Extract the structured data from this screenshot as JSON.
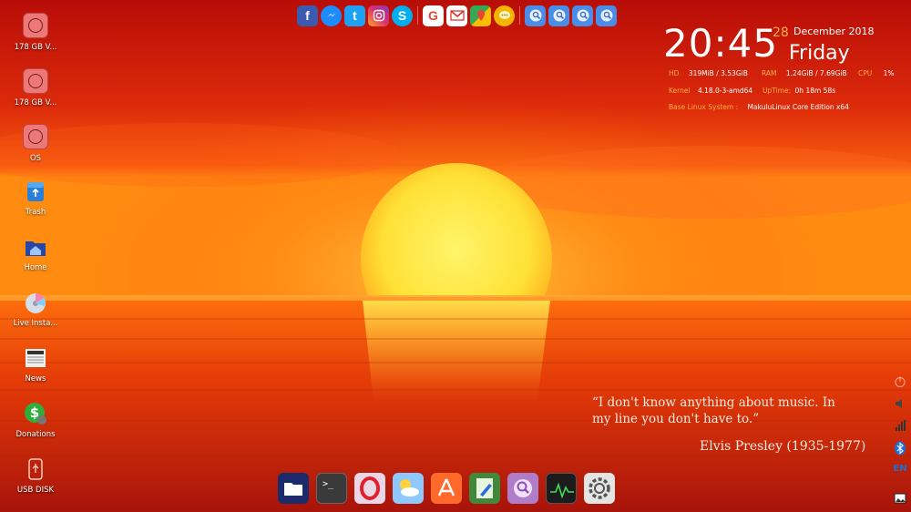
{
  "desktop": {
    "icons": [
      {
        "label": "178 GB V...",
        "icon": "disk-icon"
      },
      {
        "label": "178 GB V...",
        "icon": "disk-icon"
      },
      {
        "label": "OS",
        "icon": "disk-icon"
      },
      {
        "label": "Trash",
        "icon": "trash-icon"
      },
      {
        "label": "Home",
        "icon": "home-folder-icon"
      },
      {
        "label": "Live Insta...",
        "icon": "installer-disc-icon"
      },
      {
        "label": "News",
        "icon": "newspaper-icon"
      },
      {
        "label": "Donations",
        "icon": "dollar-icon"
      },
      {
        "label": "USB DISK",
        "icon": "usb-icon"
      }
    ]
  },
  "top_launcher": {
    "items": [
      "facebook-icon",
      "messenger-icon",
      "twitter-icon",
      "instagram-icon",
      "skype-icon",
      "google-icon",
      "gmail-icon",
      "google-maps-icon",
      "chat-bubble-icon",
      "web-app-icon",
      "web-app-icon",
      "web-app-icon",
      "web-app-icon"
    ]
  },
  "clock": {
    "time": "20:45",
    "day": "28",
    "month_year": "December 2018",
    "weekday": "Friday"
  },
  "system_info": {
    "hd_label": "HD",
    "hd_value": "319MiB / 3.53GiB",
    "ram_label": "RAM",
    "ram_value": "1.24GiB / 7.69GiB",
    "cpu_label": "CPU",
    "cpu_value": "1%",
    "kernel_label": "Kernel",
    "kernel_value": "4.18.0-3-amd64",
    "uptime_label": "UpTime:",
    "uptime_value": "0h 18m 58s",
    "base_label": "Base Linux System :",
    "base_value": "MakuluLinux Core Edition x64"
  },
  "quote": {
    "text": "“I don't know anything about music. In my line you don't have to.”",
    "author": "Elvis Presley (1935-1977)"
  },
  "dock": {
    "items": [
      "file-manager-icon",
      "terminal-icon",
      "opera-browser-icon",
      "weather-icon",
      "app-store-icon",
      "text-editor-icon",
      "media-player-icon",
      "system-monitor-icon",
      "settings-icon"
    ],
    "terminal_glyph": ">_"
  },
  "tray": {
    "language": "EN",
    "items": [
      "power-icon",
      "volume-icon",
      "network-signal-icon",
      "bluetooth-icon",
      "language-indicator",
      "screenshot-icon"
    ]
  },
  "colors": {
    "accent_orange": "#ffb04a",
    "sky_top": "#c4150c",
    "sun_core": "#ffe135"
  }
}
